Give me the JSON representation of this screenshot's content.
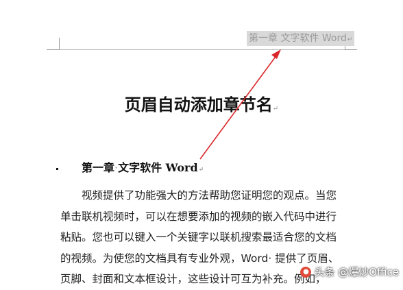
{
  "header": {
    "field_text": "第一章 文字软件 Word",
    "para_mark": "↵"
  },
  "document": {
    "title": "页眉自动添加章节名",
    "title_mark": "↵",
    "heading1": {
      "part1": "第一章",
      "separator": "·",
      "part2": "文字软件 Word",
      "mark": "↵"
    },
    "body_lines": [
      "　　视频提供了功能强大的方法帮助您证明您的观点。当您",
      "单击联机视频时，可以在想要添加的视频的嵌入代码中进行",
      "粘贴。您也可以键入一个关键字以联机搜索最适合您的文档",
      "的视频。为使您的文档具有专业外观，Word· 提供了页眉、",
      "页脚、封面和文本框设计，这些设计可互为补充。例如，"
    ]
  },
  "annotation": {
    "arrow_color": "#d9262b"
  },
  "watermark": {
    "icon": "toutiao-icon",
    "text": "头条 @爆炒Office"
  }
}
